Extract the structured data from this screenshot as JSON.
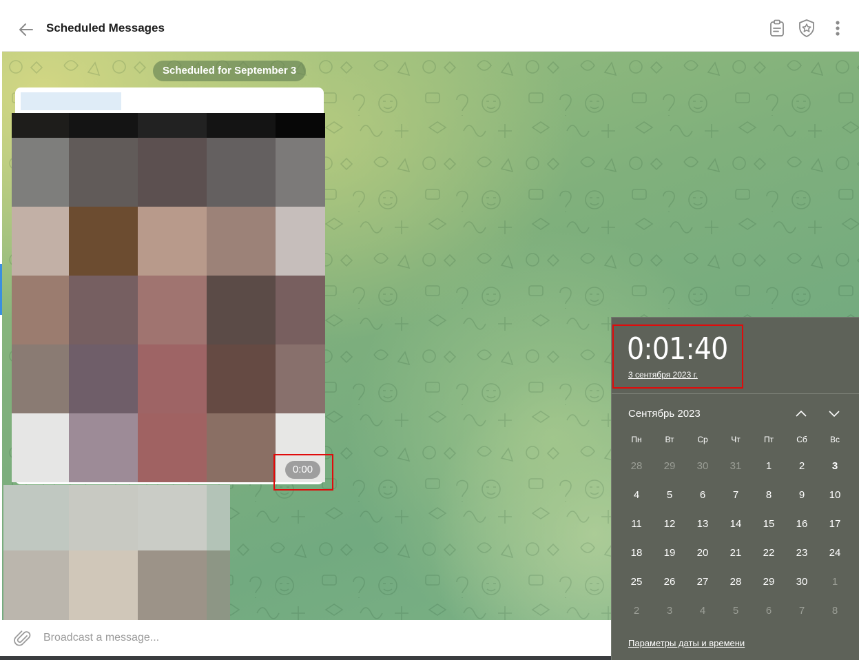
{
  "header": {
    "title": "Scheduled Messages",
    "back_icon": "arrow-left-icon",
    "actions": [
      "clipboard-icon",
      "shield-star-icon",
      "more-vertical-icon"
    ]
  },
  "chat": {
    "date_pill": "Scheduled for September 3",
    "message": {
      "time": "0:00",
      "photo_colors": [
        [
          "#1e1d1b",
          "#141414",
          "#222222",
          "#141414",
          "#070707"
        ],
        [
          "#7e7e7c",
          "#615b59",
          "#5c5050",
          "#646060",
          "#7c7a79"
        ],
        [
          "#c2b0a6",
          "#6c4c30",
          "#b89a8b",
          "#9c8278",
          "#c6bebb"
        ],
        [
          "#9b7c6f",
          "#765f61",
          "#a07470",
          "#5b4b47",
          "#785f5f"
        ],
        [
          "#8a7b73",
          "#6f5e69",
          "#9e6465",
          "#654a43",
          "#88706c"
        ],
        [
          "#e6e6e5",
          "#9d8b97",
          "#a06262",
          "#8a6f64",
          "#e7e7e5"
        ]
      ],
      "photo2_colors": [
        [
          "#c0c8c1",
          "#c8c9c2",
          "#caccc6",
          "#b3c3b7"
        ],
        [
          "#bbb6ad",
          "#d0c7b9",
          "#9c9388",
          "#8d9685"
        ]
      ]
    }
  },
  "composer": {
    "placeholder": "Broadcast a message...",
    "attach_icon": "paperclip-icon"
  },
  "flyout": {
    "time": "0:01:40",
    "date": "3 сентября 2023 г.",
    "month": "Сентябрь 2023",
    "weekdays": [
      "Пн",
      "Вт",
      "Ср",
      "Чт",
      "Пт",
      "Сб",
      "Вс"
    ],
    "days": [
      {
        "d": "28",
        "muted": true
      },
      {
        "d": "29",
        "muted": true
      },
      {
        "d": "30",
        "muted": true
      },
      {
        "d": "31",
        "muted": true
      },
      {
        "d": "1"
      },
      {
        "d": "2"
      },
      {
        "d": "3",
        "selected": true
      },
      {
        "d": "4"
      },
      {
        "d": "5"
      },
      {
        "d": "6"
      },
      {
        "d": "7"
      },
      {
        "d": "8"
      },
      {
        "d": "9"
      },
      {
        "d": "10"
      },
      {
        "d": "11"
      },
      {
        "d": "12"
      },
      {
        "d": "13"
      },
      {
        "d": "14"
      },
      {
        "d": "15"
      },
      {
        "d": "16"
      },
      {
        "d": "17"
      },
      {
        "d": "18"
      },
      {
        "d": "19"
      },
      {
        "d": "20"
      },
      {
        "d": "21"
      },
      {
        "d": "22"
      },
      {
        "d": "23"
      },
      {
        "d": "24"
      },
      {
        "d": "25"
      },
      {
        "d": "26"
      },
      {
        "d": "27"
      },
      {
        "d": "28"
      },
      {
        "d": "29"
      },
      {
        "d": "30"
      },
      {
        "d": "1",
        "muted": true
      },
      {
        "d": "2",
        "muted": true
      },
      {
        "d": "3",
        "muted": true
      },
      {
        "d": "4",
        "muted": true
      },
      {
        "d": "5",
        "muted": true
      },
      {
        "d": "6",
        "muted": true
      },
      {
        "d": "7",
        "muted": true
      },
      {
        "d": "8",
        "muted": true
      }
    ],
    "settings_link": "Параметры даты и времени",
    "prev_icon": "chevron-up-icon",
    "next_icon": "chevron-down-icon"
  },
  "colors": {
    "highlight": "#e00b0b",
    "flyout_bg": "#5e6259",
    "date_pill_bg": "#628052"
  }
}
